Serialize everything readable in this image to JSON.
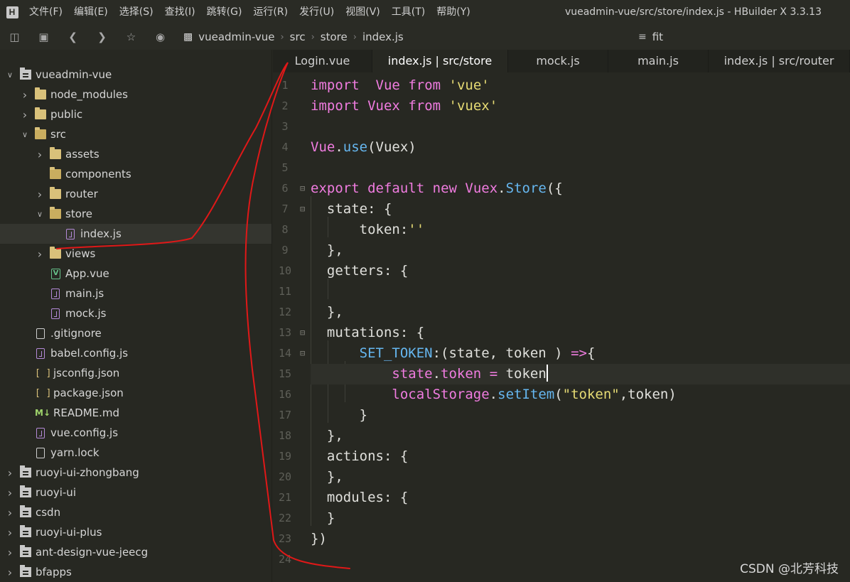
{
  "menubar": {
    "logo": "H",
    "items": [
      "文件(F)",
      "编辑(E)",
      "选择(S)",
      "查找(I)",
      "跳转(G)",
      "运行(R)",
      "发行(U)",
      "视图(V)",
      "工具(T)",
      "帮助(Y)"
    ],
    "window_title": "vueadmin-vue/src/store/index.js - HBuilder X 3.3.13"
  },
  "toolbar": {
    "breadcrumb": [
      "vueadmin-vue",
      "src",
      "store",
      "index.js"
    ],
    "search_value": "fit"
  },
  "sidebar": {
    "items": [
      {
        "label": "vueadmin-vue",
        "depth": 0,
        "expanded": true,
        "icon": "project"
      },
      {
        "label": "node_modules",
        "depth": 1,
        "expanded": false,
        "icon": "folder"
      },
      {
        "label": "public",
        "depth": 1,
        "expanded": false,
        "icon": "folder"
      },
      {
        "label": "src",
        "depth": 1,
        "expanded": true,
        "icon": "folder-open"
      },
      {
        "label": "assets",
        "depth": 2,
        "expanded": false,
        "icon": "folder"
      },
      {
        "label": "components",
        "depth": 2,
        "expanded": null,
        "icon": "folder-open"
      },
      {
        "label": "router",
        "depth": 2,
        "expanded": false,
        "icon": "folder"
      },
      {
        "label": "store",
        "depth": 2,
        "expanded": true,
        "icon": "folder-open"
      },
      {
        "label": "index.js",
        "depth": 3,
        "expanded": null,
        "icon": "js",
        "selected": true
      },
      {
        "label": "views",
        "depth": 2,
        "expanded": false,
        "icon": "folder"
      },
      {
        "label": "App.vue",
        "depth": 2,
        "expanded": null,
        "icon": "vue"
      },
      {
        "label": "main.js",
        "depth": 2,
        "expanded": null,
        "icon": "js"
      },
      {
        "label": "mock.js",
        "depth": 2,
        "expanded": null,
        "icon": "js"
      },
      {
        "label": ".gitignore",
        "depth": 1,
        "expanded": null,
        "icon": "file"
      },
      {
        "label": "babel.config.js",
        "depth": 1,
        "expanded": null,
        "icon": "js"
      },
      {
        "label": "jsconfig.json",
        "depth": 1,
        "expanded": null,
        "icon": "json"
      },
      {
        "label": "package.json",
        "depth": 1,
        "expanded": null,
        "icon": "json"
      },
      {
        "label": "README.md",
        "depth": 1,
        "expanded": null,
        "icon": "md"
      },
      {
        "label": "vue.config.js",
        "depth": 1,
        "expanded": null,
        "icon": "js"
      },
      {
        "label": "yarn.lock",
        "depth": 1,
        "expanded": null,
        "icon": "file"
      },
      {
        "label": "ruoyi-ui-zhongbang",
        "depth": 0,
        "expanded": false,
        "icon": "project"
      },
      {
        "label": "ruoyi-ui",
        "depth": 0,
        "expanded": false,
        "icon": "project"
      },
      {
        "label": "csdn",
        "depth": 0,
        "expanded": false,
        "icon": "project"
      },
      {
        "label": "ruoyi-ui-plus",
        "depth": 0,
        "expanded": false,
        "icon": "project"
      },
      {
        "label": "ant-design-vue-jeecg",
        "depth": 0,
        "expanded": false,
        "icon": "project"
      },
      {
        "label": "bfapps",
        "depth": 0,
        "expanded": false,
        "icon": "project"
      }
    ]
  },
  "tabs": [
    {
      "label": "Login.vue",
      "active": false
    },
    {
      "label": "index.js | src/store",
      "active": true
    },
    {
      "label": "mock.js",
      "active": false
    },
    {
      "label": "main.js",
      "active": false
    },
    {
      "label": "index.js | src/router",
      "active": false
    }
  ],
  "editor": {
    "lines": [
      [
        [
          "kw",
          "import"
        ],
        [
          "",
          "  "
        ],
        [
          "cls",
          "Vue"
        ],
        [
          "",
          " "
        ],
        [
          "kw",
          "from"
        ],
        [
          "",
          " "
        ],
        [
          "str",
          "'vue'"
        ]
      ],
      [
        [
          "kw",
          "import"
        ],
        [
          "",
          " "
        ],
        [
          "cls",
          "Vuex"
        ],
        [
          "",
          " "
        ],
        [
          "kw",
          "from"
        ],
        [
          "",
          " "
        ],
        [
          "str",
          "'vuex'"
        ]
      ],
      [],
      [
        [
          "cls",
          "Vue"
        ],
        [
          "",
          "."
        ],
        [
          "fn",
          "use"
        ],
        [
          "",
          "(Vuex)"
        ]
      ],
      [],
      [
        [
          "kw",
          "export"
        ],
        [
          "",
          " "
        ],
        [
          "kw",
          "default"
        ],
        [
          "",
          " "
        ],
        [
          "kw",
          "new"
        ],
        [
          "",
          " "
        ],
        [
          "cls",
          "Vuex"
        ],
        [
          "",
          "."
        ],
        [
          "fn",
          "Store"
        ],
        [
          "",
          "({"
        ]
      ],
      [
        [
          "",
          "  state: {"
        ]
      ],
      [
        [
          "",
          "      token:"
        ],
        [
          "str",
          "''"
        ]
      ],
      [
        [
          "",
          "  },"
        ]
      ],
      [
        [
          "",
          "  getters: {"
        ]
      ],
      [],
      [
        [
          "",
          "  },"
        ]
      ],
      [
        [
          "",
          "  mutations: {"
        ]
      ],
      [
        [
          "",
          "      "
        ],
        [
          "fn",
          "SET_TOKEN"
        ],
        [
          "",
          ":(state, token ) "
        ],
        [
          "kw",
          "=>"
        ],
        [
          "",
          "{"
        ]
      ],
      [
        [
          "",
          "          "
        ],
        [
          "var",
          "state"
        ],
        [
          "",
          "."
        ],
        [
          "var",
          "token"
        ],
        [
          "",
          " "
        ],
        [
          "kw",
          "="
        ],
        [
          "",
          " token"
        ],
        [
          "cursor",
          ""
        ]
      ],
      [
        [
          "",
          "          "
        ],
        [
          "var",
          "localStorage"
        ],
        [
          "",
          "."
        ],
        [
          "fn",
          "setItem"
        ],
        [
          "",
          "("
        ],
        [
          "str",
          "\"token\""
        ],
        [
          "",
          ",token)"
        ]
      ],
      [
        [
          "",
          "      }"
        ]
      ],
      [
        [
          "",
          "  },"
        ]
      ],
      [
        [
          "",
          "  actions: {"
        ]
      ],
      [
        [
          "",
          "  },"
        ]
      ],
      [
        [
          "",
          "  modules: {"
        ]
      ],
      [
        [
          "",
          "  }"
        ]
      ],
      [
        [
          "",
          "})"
        ]
      ],
      []
    ],
    "folds": [
      6,
      7,
      13,
      14
    ],
    "current_line": 15
  },
  "watermark": "CSDN @北芳科技"
}
